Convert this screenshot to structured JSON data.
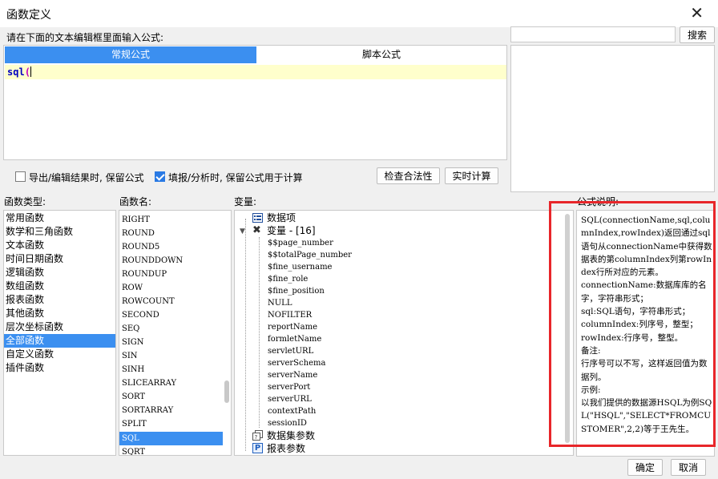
{
  "window": {
    "title": "函数定义"
  },
  "editor": {
    "prompt": "请在下面的文本编辑框里面输入公式:",
    "tabs": [
      "常规公式",
      "脚本公式"
    ],
    "code_fn": "sql",
    "code_paren": "("
  },
  "search": {
    "button": "搜索",
    "placeholder": ""
  },
  "options": {
    "export_keep": "导出/编辑结果时, 保留公式",
    "fill_keep": "填报/分析时, 保留公式用于计算",
    "export_checked": false,
    "fill_checked": true
  },
  "buttons": {
    "validate": "检查合法性",
    "realtime": "实时计算",
    "ok": "确定",
    "cancel": "取消"
  },
  "headers": {
    "types": "函数类型:",
    "names": "函数名:",
    "vars": "变量:",
    "desc": "公式说明:"
  },
  "func_types": [
    "常用函数",
    "数学和三角函数",
    "文本函数",
    "时间日期函数",
    "逻辑函数",
    "数组函数",
    "报表函数",
    "其他函数",
    "层次坐标函数",
    "全部函数",
    "自定义函数",
    "插件函数"
  ],
  "func_types_selected": "全部函数",
  "func_names": [
    "RIGHT",
    "ROUND",
    "ROUND5",
    "ROUNDDOWN",
    "ROUNDUP",
    "ROW",
    "ROWCOUNT",
    "SECOND",
    "SEQ",
    "SIGN",
    "SIN",
    "SINH",
    "SLICEARRAY",
    "SORT",
    "SORTARRAY",
    "SPLIT",
    "SQL",
    "SQRT"
  ],
  "func_names_selected": "SQL",
  "variables": {
    "data_items": "数据项",
    "vars_group": "变量 - [16]",
    "items": [
      "$$page_number",
      "$$totalPage_number",
      "$fine_username",
      "$fine_role",
      "$fine_position",
      "NULL",
      "NOFILTER",
      "reportName",
      "formletName",
      "servletURL",
      "serverSchema",
      "serverName",
      "serverPort",
      "serverURL",
      "contextPath",
      "sessionID"
    ],
    "dataset_params": "数据集参数",
    "report_params": "报表参数"
  },
  "description": [
    "SQL(connectionName,sql,columnIndex,rowIndex)返回通过sql语句从connectionName中获得数据表的第columnIndex列第rowIndex行所对应的元素。",
    "connectionName:数据库库的名字，字符串形式；",
    "sql:SQL语句，字符串形式；",
    "columnIndex:列序号，整型；",
    "rowIndex:行序号，整型。",
    "备注:",
    "行序号可以不写，这样返回值为数据列。",
    "示例:",
    "以我们提供的数据源HSQL为例SQL(\"HSQL\",\"SELECT*FROMCUSTOMER\",2,2)等于王先生。"
  ],
  "colors": {
    "accent": "#3b8ff0",
    "highlight_border": "#e8262a",
    "code_bg": "#ffffcc"
  }
}
